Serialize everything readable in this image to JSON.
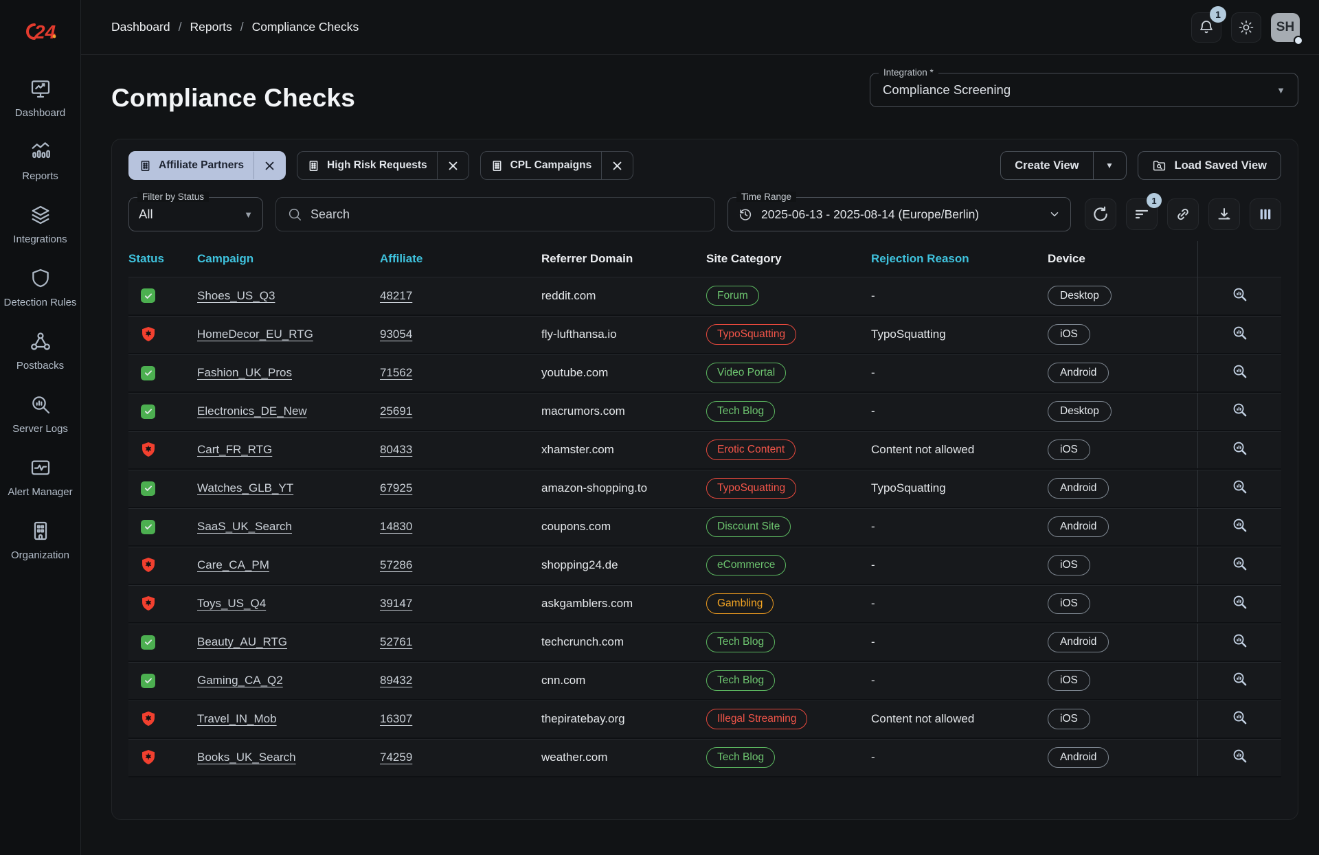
{
  "colors": {
    "accent_cyan": "#3fc2dd",
    "approved_green": "#4caf50",
    "rejected_red": "#f2402f",
    "pill_green": "#6dc46f",
    "pill_red": "#f25549",
    "pill_orange": "#f5a623",
    "active_chip": "#b7c3dd",
    "badge_blue": "#b3cbdd",
    "logo_red": "#e23b2e"
  },
  "brand": {
    "logo_text": "24"
  },
  "breadcrumb": {
    "items": [
      "Dashboard",
      "Reports",
      "Compliance Checks"
    ],
    "separator": "/"
  },
  "topbar": {
    "notification_count": "1",
    "avatar_initials": "SH"
  },
  "sidebar": {
    "items": [
      {
        "label": "Dashboard",
        "icon": "dashboard-icon"
      },
      {
        "label": "Reports",
        "icon": "reports-icon"
      },
      {
        "label": "Integrations",
        "icon": "integrations-icon"
      },
      {
        "label": "Detection Rules",
        "icon": "detection-rules-icon"
      },
      {
        "label": "Postbacks",
        "icon": "postbacks-icon"
      },
      {
        "label": "Server Logs",
        "icon": "server-logs-icon"
      },
      {
        "label": "Alert Manager",
        "icon": "alert-manager-icon"
      },
      {
        "label": "Organization",
        "icon": "organization-icon"
      }
    ]
  },
  "page": {
    "title": "Compliance Checks"
  },
  "integration": {
    "label": "Integration *",
    "value": "Compliance Screening"
  },
  "saved_views": {
    "chips": [
      {
        "label": "Affiliate Partners",
        "active": true
      },
      {
        "label": "High Risk Requests",
        "active": false
      },
      {
        "label": "CPL Campaigns",
        "active": false
      }
    ],
    "create_view_label": "Create View",
    "load_saved_view_label": "Load Saved View"
  },
  "filters": {
    "status": {
      "label": "Filter by Status",
      "value": "All"
    },
    "search": {
      "placeholder": "Search"
    },
    "time_range": {
      "label": "Time Range",
      "value": "2025-06-13 - 2025-08-14 (Europe/Berlin)"
    },
    "filter_badge": "1"
  },
  "table": {
    "columns": [
      {
        "label": "Status",
        "accent": true
      },
      {
        "label": "Campaign",
        "accent": true
      },
      {
        "label": "Affiliate",
        "accent": true
      },
      {
        "label": "Referrer Domain",
        "accent": false
      },
      {
        "label": "Site Category",
        "accent": false
      },
      {
        "label": "Rejection Reason",
        "accent": true
      },
      {
        "label": "Device",
        "accent": false
      },
      {
        "label": "",
        "accent": false
      }
    ],
    "rows": [
      {
        "status": "approved",
        "campaign": "Shoes_US_Q3",
        "affiliate": "48217",
        "referrer": "reddit.com",
        "category": {
          "label": "Forum",
          "color": "green"
        },
        "rejection": "-",
        "device": "Desktop"
      },
      {
        "status": "rejected",
        "campaign": "HomeDecor_EU_RTG",
        "affiliate": "93054",
        "referrer": "fly-lufthansa.io",
        "category": {
          "label": "TypoSquatting",
          "color": "red"
        },
        "rejection": "TypoSquatting",
        "device": "iOS"
      },
      {
        "status": "approved",
        "campaign": "Fashion_UK_Pros",
        "affiliate": "71562",
        "referrer": "youtube.com",
        "category": {
          "label": "Video Portal",
          "color": "green"
        },
        "rejection": "-",
        "device": "Android"
      },
      {
        "status": "approved",
        "campaign": "Electronics_DE_New",
        "affiliate": "25691",
        "referrer": "macrumors.com",
        "category": {
          "label": "Tech Blog",
          "color": "green"
        },
        "rejection": "-",
        "device": "Desktop"
      },
      {
        "status": "rejected",
        "campaign": "Cart_FR_RTG",
        "affiliate": "80433",
        "referrer": "xhamster.com",
        "category": {
          "label": "Erotic Content",
          "color": "red"
        },
        "rejection": "Content not allowed",
        "device": "iOS"
      },
      {
        "status": "approved",
        "campaign": "Watches_GLB_YT",
        "affiliate": "67925",
        "referrer": "amazon-shopping.to",
        "category": {
          "label": "TypoSquatting",
          "color": "red"
        },
        "rejection": "TypoSquatting",
        "device": "Android"
      },
      {
        "status": "approved",
        "campaign": "SaaS_UK_Search",
        "affiliate": "14830",
        "referrer": "coupons.com",
        "category": {
          "label": "Discount Site",
          "color": "green"
        },
        "rejection": "-",
        "device": "Android"
      },
      {
        "status": "rejected",
        "campaign": "Care_CA_PM",
        "affiliate": "57286",
        "referrer": "shopping24.de",
        "category": {
          "label": "eCommerce",
          "color": "green"
        },
        "rejection": "-",
        "device": "iOS"
      },
      {
        "status": "rejected",
        "campaign": "Toys_US_Q4",
        "affiliate": "39147",
        "referrer": "askgamblers.com",
        "category": {
          "label": "Gambling",
          "color": "orange"
        },
        "rejection": "-",
        "device": "iOS"
      },
      {
        "status": "approved",
        "campaign": "Beauty_AU_RTG",
        "affiliate": "52761",
        "referrer": "techcrunch.com",
        "category": {
          "label": "Tech Blog",
          "color": "green"
        },
        "rejection": "-",
        "device": "Android"
      },
      {
        "status": "approved",
        "campaign": "Gaming_CA_Q2",
        "affiliate": "89432",
        "referrer": "cnn.com",
        "category": {
          "label": "Tech Blog",
          "color": "green"
        },
        "rejection": "-",
        "device": "iOS"
      },
      {
        "status": "rejected",
        "campaign": "Travel_IN_Mob",
        "affiliate": "16307",
        "referrer": "thepiratebay.org",
        "category": {
          "label": "Illegal Streaming",
          "color": "red"
        },
        "rejection": "Content not allowed",
        "device": "iOS"
      },
      {
        "status": "rejected",
        "campaign": "Books_UK_Search",
        "affiliate": "74259",
        "referrer": "weather.com",
        "category": {
          "label": "Tech Blog",
          "color": "green"
        },
        "rejection": "-",
        "device": "Android"
      }
    ]
  }
}
